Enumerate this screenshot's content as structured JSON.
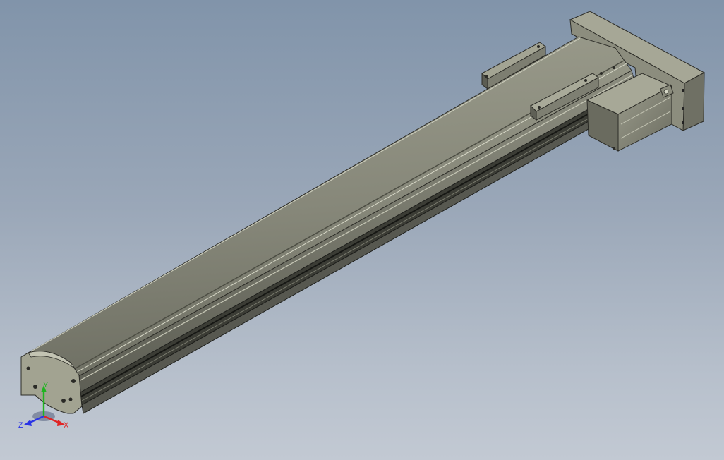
{
  "viewport": {
    "background_top": "#8194aa",
    "background_bottom": "#c2c9d3"
  },
  "model": {
    "body_color": "#8a8b7c",
    "body_light": "#b5b6a6",
    "body_dark": "#4e4f45",
    "rail_shadow": "#1e1f1c"
  },
  "triad": {
    "x_label": "X",
    "y_label": "Y",
    "z_label": "Z",
    "x_color": "#e02424",
    "y_color": "#1fb41f",
    "z_color": "#2a34e6"
  }
}
